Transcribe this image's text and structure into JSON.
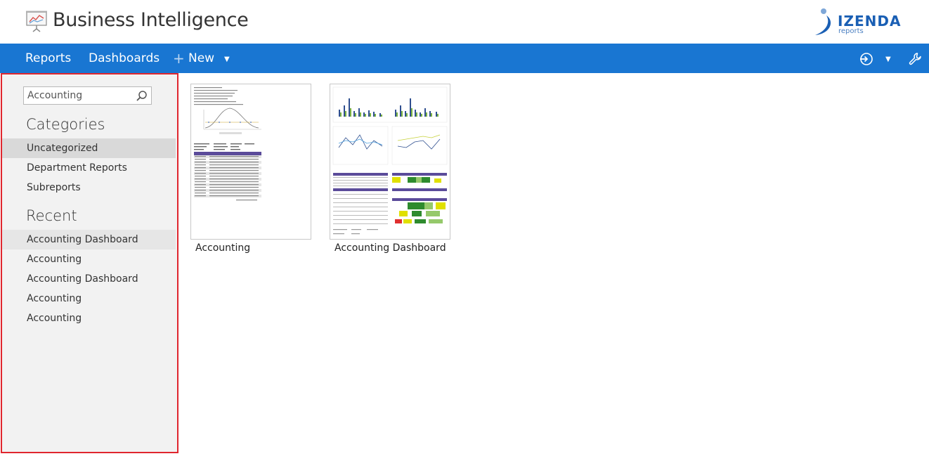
{
  "header": {
    "title": "Business Intelligence",
    "brand_name": "IZENDA",
    "brand_sub": "reports"
  },
  "nav": {
    "reports": "Reports",
    "dashboards": "Dashboards",
    "new": "New"
  },
  "sidebar": {
    "search": {
      "value": "Accounting",
      "placeholder": ""
    },
    "categories_title": "Categories",
    "categories": [
      {
        "label": "Uncategorized",
        "selected": true
      },
      {
        "label": "Department Reports"
      },
      {
        "label": "Subreports"
      }
    ],
    "recent_title": "Recent",
    "recent": [
      {
        "label": "Accounting Dashboard",
        "hover": true
      },
      {
        "label": "Accounting"
      },
      {
        "label": "Accounting Dashboard"
      },
      {
        "label": "Accounting"
      },
      {
        "label": "Accounting"
      }
    ]
  },
  "main": {
    "items": [
      {
        "label": "Accounting",
        "type": "report"
      },
      {
        "label": "Accounting Dashboard",
        "type": "dashboard"
      }
    ]
  },
  "colors": {
    "navbar": "#1976d2",
    "sidebar_bg": "#f2f2f2",
    "sidebar_border": "#e0262e",
    "selected_item": "#d9d9d9",
    "brand": "#1a5fb4"
  }
}
